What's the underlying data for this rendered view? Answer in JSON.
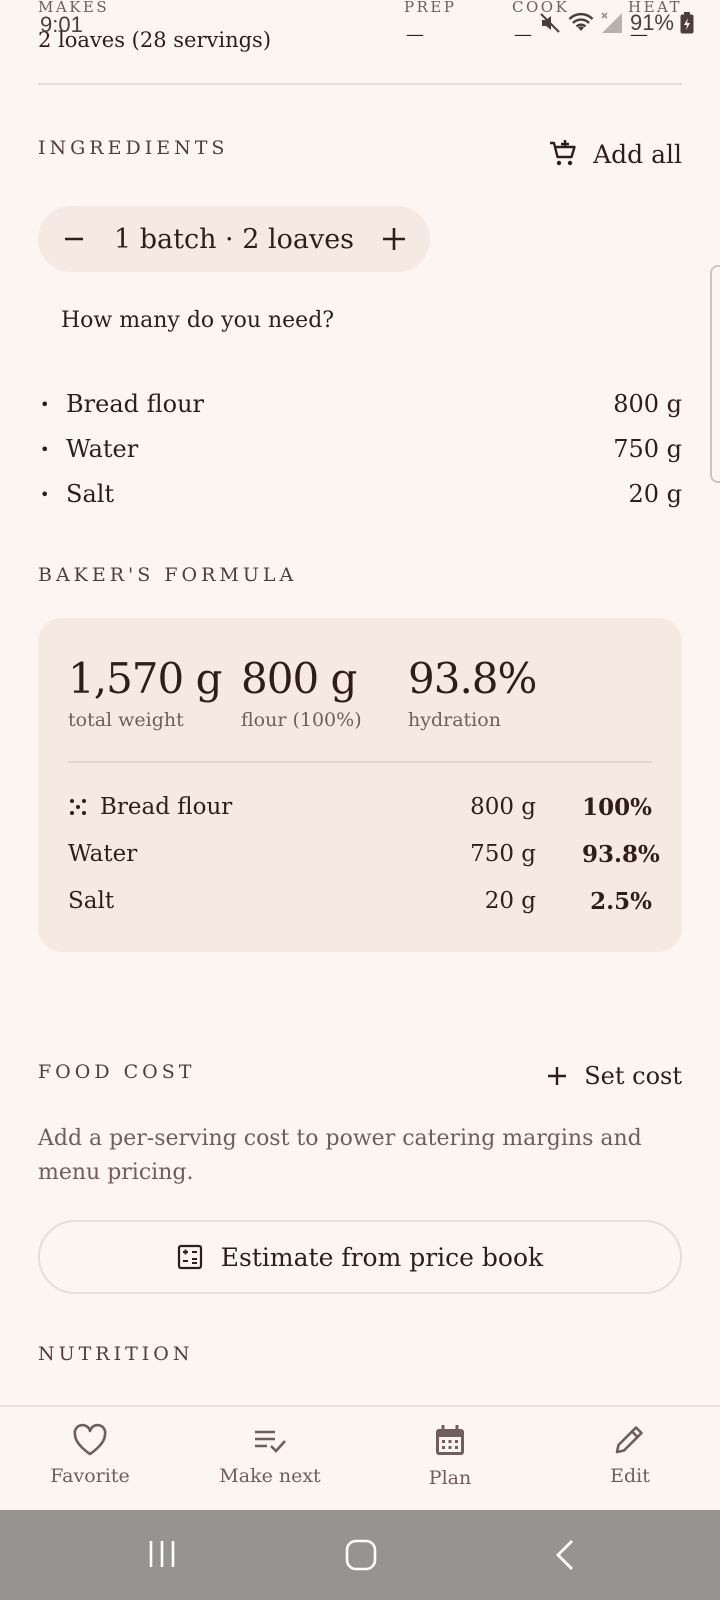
{
  "status_bar": {
    "time": "9:01",
    "battery": "91%"
  },
  "meta": {
    "makes_label": "MAKES",
    "makes_value": "2 loaves (28 servings)",
    "prep_label": "PREP",
    "prep_value": "—",
    "cook_label": "COOK",
    "cook_value": "—",
    "heat_label": "HEAT",
    "heat_value": "—"
  },
  "ingredients": {
    "title": "INGREDIENTS",
    "add_all_label": "Add all",
    "stepper_label": "1 batch · 2 loaves",
    "helper_text": "How many do you need?",
    "items": [
      {
        "name": "Bread flour",
        "amount": "800 g"
      },
      {
        "name": "Water",
        "amount": "750 g"
      },
      {
        "name": "Salt",
        "amount": "20 g"
      }
    ]
  },
  "bakers_formula": {
    "title": "BAKER'S FORMULA",
    "stats": [
      {
        "value": "1,570 g",
        "label": "total weight"
      },
      {
        "value": "800 g",
        "label": "flour (100%)"
      },
      {
        "value": "93.8%",
        "label": "hydration"
      }
    ],
    "rows": [
      {
        "name": "Bread flour",
        "weight": "800 g",
        "percent": "100%",
        "is_flour": true
      },
      {
        "name": "Water",
        "weight": "750 g",
        "percent": "93.8%",
        "is_flour": false
      },
      {
        "name": "Salt",
        "weight": "20 g",
        "percent": "2.5%",
        "is_flour": false
      }
    ]
  },
  "food_cost": {
    "title": "FOOD COST",
    "set_cost_label": "Set cost",
    "description": "Add a per-serving cost to power catering margins and menu pricing.",
    "estimate_label": "Estimate from price book"
  },
  "nutrition": {
    "title": "NUTRITION"
  },
  "bottom_nav": [
    {
      "label": "Favorite",
      "icon": "heart-icon"
    },
    {
      "label": "Make next",
      "icon": "playlist-check-icon"
    },
    {
      "label": "Plan",
      "icon": "calendar-icon"
    },
    {
      "label": "Edit",
      "icon": "pencil-icon"
    }
  ],
  "colors": {
    "background": "#fcf5f1",
    "text": "#2e1e1a",
    "card": "#f6e8e2",
    "system_nav": "#979391"
  }
}
